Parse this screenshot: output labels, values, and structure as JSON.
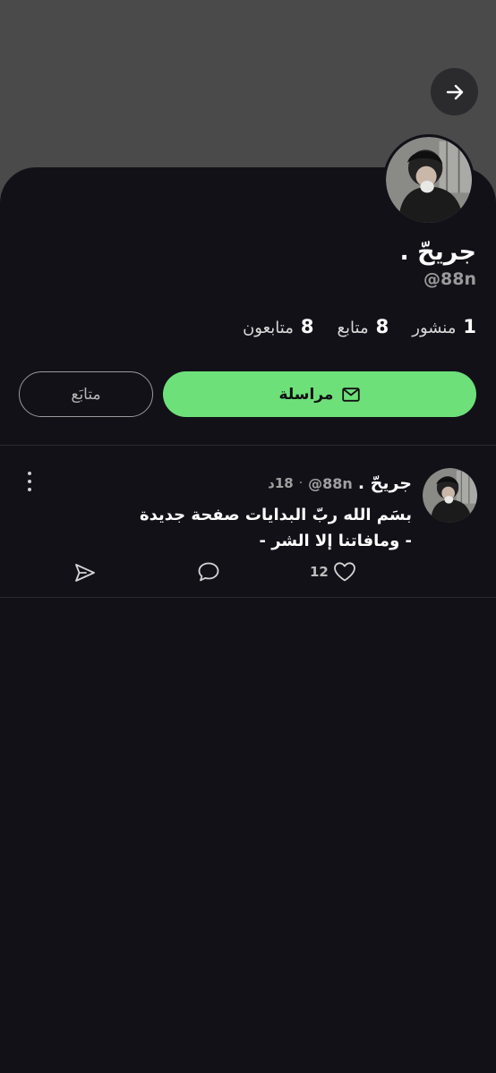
{
  "header": {
    "back_icon": "arrow-right-icon"
  },
  "profile": {
    "name": "جريحّ .",
    "handle": "@88n",
    "avatar_icon": "profile-photo",
    "stats": [
      {
        "value": "8",
        "label": "متابعون"
      },
      {
        "value": "8",
        "label": "متابع"
      },
      {
        "value": "1",
        "label": "منشور"
      }
    ]
  },
  "actions": {
    "message_label": "مراسلة",
    "message_icon": "mail-icon",
    "follow_label": "متابَع"
  },
  "post": {
    "author_name": "جريحّ .",
    "author_handle": "@88n",
    "separator": "·",
    "time": "18د",
    "lines": [
      "بسَم الله ربّ البدايات صفحة جديدة",
      "- ومافاتنا إلا الشر -"
    ],
    "like_count": "12",
    "like_icon": "heart-icon",
    "comment_icon": "comment-icon",
    "share_icon": "send-icon",
    "more_icon": "more-vertical-icon"
  },
  "colors": {
    "background": "#121118",
    "cover": "#4a4a4a",
    "accent": "#6ee07a",
    "muted": "#9a9a9a"
  }
}
